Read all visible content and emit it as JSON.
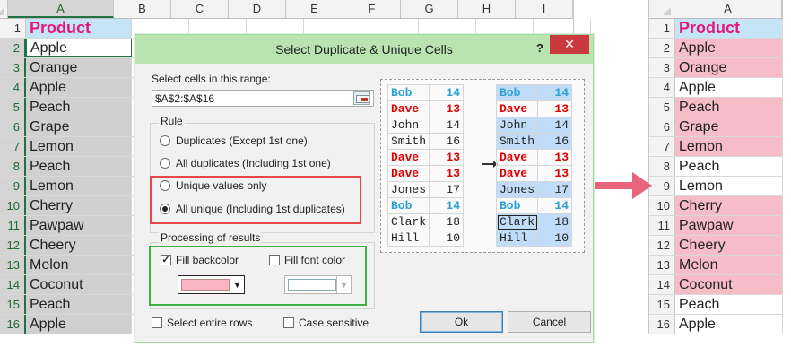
{
  "left_sheet": {
    "columns": [
      "A",
      "B",
      "C",
      "D",
      "E",
      "F",
      "G",
      "H",
      "I"
    ],
    "row_numbers": [
      "1",
      "2",
      "3",
      "4",
      "5",
      "6",
      "7",
      "8",
      "9",
      "10",
      "11",
      "12",
      "13",
      "14",
      "15",
      "16"
    ],
    "header": "Product",
    "values": [
      "Apple",
      "Orange",
      "Apple",
      "Peach",
      "Grape",
      "Lemon",
      "Peach",
      "Lemon",
      "Cherry",
      "Pawpaw",
      "Cheery",
      "Melon",
      "Coconut",
      "Peach",
      "Apple"
    ]
  },
  "right_sheet": {
    "columns": [
      "A"
    ],
    "row_numbers": [
      "1",
      "2",
      "3",
      "4",
      "5",
      "6",
      "7",
      "8",
      "9",
      "10",
      "11",
      "12",
      "13",
      "14",
      "15",
      "16"
    ],
    "header": "Product",
    "values": [
      "Apple",
      "Orange",
      "Apple",
      "Peach",
      "Grape",
      "Lemon",
      "Peach",
      "Lemon",
      "Cherry",
      "Pawpaw",
      "Cheery",
      "Melon",
      "Coconut",
      "Peach",
      "Apple"
    ],
    "highlighted": [
      true,
      true,
      false,
      true,
      true,
      true,
      false,
      false,
      true,
      true,
      true,
      true,
      true,
      false,
      false
    ],
    "highlight_color": "#f6bcc8"
  },
  "dialog": {
    "title": "Select Duplicate & Unique Cells",
    "help": "?",
    "close": "✕",
    "range_label": "Select cells in this range:",
    "range_value": "$A$2:$A$16",
    "rule_label": "Rule",
    "rules": [
      "Duplicates (Except 1st one)",
      "All duplicates (Including 1st one)",
      "Unique values only",
      "All unique (Including 1st duplicates)"
    ],
    "selected_rule": 3,
    "processing_label": "Processing of results",
    "fill_backcolor": "Fill backcolor",
    "fill_backcolor_checked": true,
    "fill_font_color": "Fill font color",
    "fill_font_color_checked": false,
    "backcolor_swatch": "#f8b4c0",
    "select_entire_rows": "Select entire rows",
    "case_sensitive": "Case sensitive",
    "ok": "Ok",
    "cancel": "Cancel"
  },
  "preview": {
    "before": [
      [
        "Bob",
        "14",
        "blue"
      ],
      [
        "Dave",
        "13",
        "red"
      ],
      [
        "John",
        "14",
        "dark"
      ],
      [
        "Smith",
        "16",
        "dark"
      ],
      [
        "Dave",
        "13",
        "red"
      ],
      [
        "Dave",
        "13",
        "red"
      ],
      [
        "Jones",
        "17",
        "dark"
      ],
      [
        "Bob",
        "14",
        "blue"
      ],
      [
        "Clark",
        "18",
        "dark"
      ],
      [
        "Hill",
        "10",
        "dark"
      ]
    ],
    "after_highlight": [
      true,
      false,
      true,
      true,
      false,
      false,
      true,
      false,
      true,
      true
    ]
  }
}
